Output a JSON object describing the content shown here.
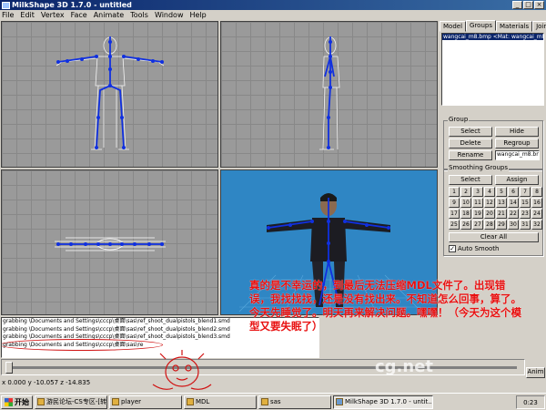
{
  "window": {
    "title": "MilkShape 3D 1.7.0 - untitled",
    "controls": [
      "_",
      "□",
      "×"
    ]
  },
  "menu": [
    "File",
    "Edit",
    "Vertex",
    "Face",
    "Animate",
    "Tools",
    "Window",
    "Help"
  ],
  "panel": {
    "tabs": [
      "Model",
      "Groups",
      "Materials",
      "Joints"
    ],
    "active_tab": "Groups",
    "group_list": [
      "wangcai_m8.bmp <Mat: wangcai_m8"
    ],
    "group_section": {
      "legend": "Group",
      "select": "Select",
      "hide": "Hide",
      "delete": "Delete",
      "regroup": "Regroup",
      "rename": "Rename",
      "name_value": "wangcai_m8.bn"
    },
    "smoothing": {
      "legend": "Smoothing Groups",
      "select": "Select",
      "assign": "Assign",
      "numbers": [
        "1",
        "2",
        "3",
        "4",
        "5",
        "6",
        "7",
        "8",
        "9",
        "10",
        "11",
        "12",
        "13",
        "14",
        "15",
        "16",
        "17",
        "18",
        "19",
        "20",
        "21",
        "22",
        "23",
        "24",
        "25",
        "26",
        "27",
        "28",
        "29",
        "30",
        "31",
        "32"
      ],
      "clear_all": "Clear All",
      "auto_smooth": "Auto Smooth",
      "auto_smooth_checked": true
    }
  },
  "log": [
    "grabbing \\Documents and Settings\\cccp\\桌面\\sas\\ref_shoot_dualpistols_blend1.smd",
    "grabbing \\Documents and Settings\\cccp\\桌面\\sas\\ref_shoot_dualpistols_blend2.smd",
    "grabbing \\Documents and Settings\\cccp\\桌面\\sas\\ref_shoot_dualpistols_blend3.smd",
    "grabbing \\Documents and Settings\\cccp\\桌面\\sas\\re"
  ],
  "timeline": {
    "anim_label": "Anim"
  },
  "status": "x 0.000 y -10.057 z -14.835",
  "annotation": "真的是不幸运的，到最后无法压缩MDL文件了。出现错误，我找找找，还是没有找出来。不知道怎么回事，算了。今天先睡觉了。明天再来解决问题。嘿嘿！（今天为这个模型又要失眠了）",
  "watermark": "cg.net",
  "taskbar": {
    "start": "开始",
    "tasks": [
      "游民论坛-CS专区-[转...",
      "player",
      "MDL",
      "sas",
      "MilkShape 3D 1.7.0 - untit..."
    ],
    "active_index": 4,
    "clock": "0:23"
  },
  "colors": {
    "skeleton": "#1030e0",
    "wireframe": "#ffffff",
    "viewport_grid": "#9a9a9a",
    "viewport_3d": "#2f86c4",
    "annotation": "#e81010"
  }
}
